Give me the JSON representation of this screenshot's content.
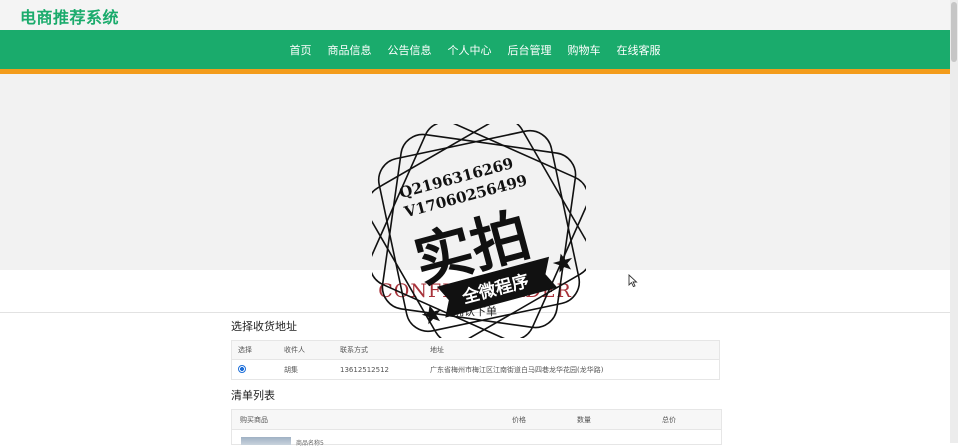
{
  "site": {
    "title": "电商推荐系统"
  },
  "nav": {
    "items": [
      {
        "label": "首页"
      },
      {
        "label": "商品信息"
      },
      {
        "label": "公告信息"
      },
      {
        "label": "个人中心"
      },
      {
        "label": "后台管理"
      },
      {
        "label": "购物车"
      },
      {
        "label": "在线客服"
      }
    ]
  },
  "hero": {
    "title_en": "CONFIRM ORDER",
    "title_cn": "确认下单"
  },
  "address": {
    "section_title": "选择收货地址",
    "columns": [
      "选择",
      "收件人",
      "联系方式",
      "地址"
    ],
    "rows": [
      {
        "recipient": "胡集",
        "phone": "13612512512",
        "address": "广东省梅州市梅江区江南街道白马四巷龙华花园(龙华路)"
      }
    ]
  },
  "cart": {
    "section_title": "清单列表",
    "columns": [
      "购买商品",
      "价格",
      "数量",
      "总价"
    ],
    "rows": [
      {
        "name": "商品名称5"
      }
    ]
  },
  "watermark": {
    "line1": "Q2196316269",
    "line2": "V17060256499",
    "main": "实拍",
    "banner": "全微程序"
  },
  "colors": {
    "brand_green": "#1aab6c",
    "accent_orange": "#f39c1c",
    "hero_red": "#a8323a"
  }
}
